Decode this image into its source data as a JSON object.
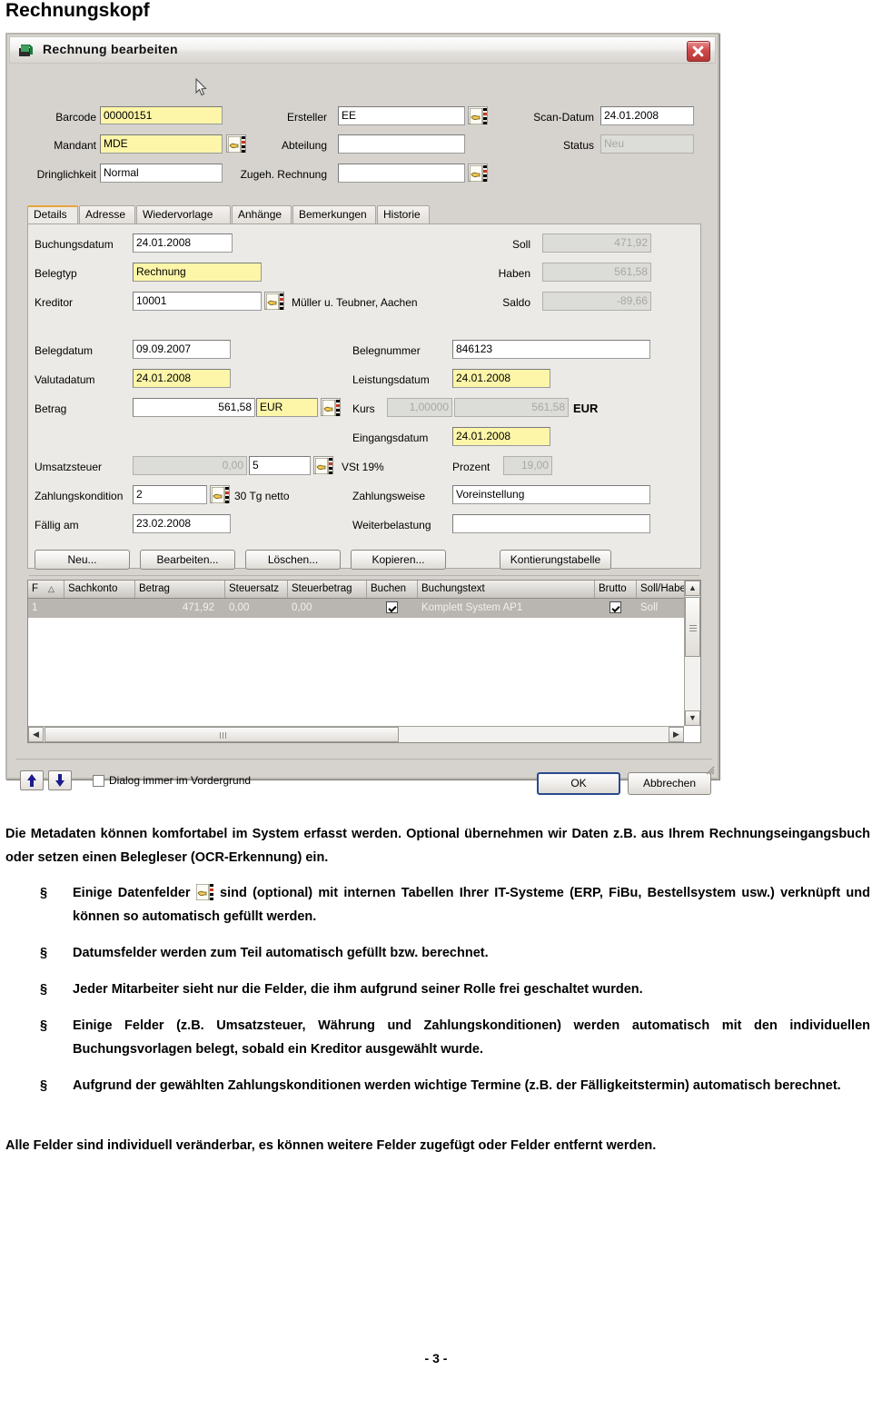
{
  "document": {
    "title": "Rechnungskopf",
    "page_number": "- 3 -",
    "intro": "Die Metadaten können komfortabel im System erfasst werden. Optional übernehmen wir Daten z.B. aus Ihrem Rechnungseingangsbuch oder setzen einen Belegleser (OCR-Erkennung) ein.",
    "bullet_marker": "§",
    "bullets": [
      {
        "before": "Einige Datenfelder",
        "after": "sind (optional) mit internen Tabellen Ihrer IT-Systeme (ERP, FiBu, Bestellsystem usw.)  verknüpft und können so automatisch gefüllt werden.",
        "has_icon": true
      },
      {
        "before": "Datumsfelder werden zum Teil automatisch gefüllt bzw. berechnet.",
        "after": "",
        "has_icon": false
      },
      {
        "before": "Jeder Mitarbeiter sieht nur die Felder, die ihm aufgrund seiner Rolle frei geschaltet wurden.",
        "after": "",
        "has_icon": false
      },
      {
        "before": "Einige Felder (z.B. Umsatzsteuer, Währung und Zahlungskonditionen) werden automatisch mit den individuellen Buchungsvorlagen belegt, sobald ein Kreditor ausgewählt wurde.",
        "after": "",
        "has_icon": false
      },
      {
        "before": "Aufgrund der gewählten Zahlungskonditionen werden wichtige Termine (z.B. der Fälligkeitstermin) automatisch berechnet.",
        "after": "",
        "has_icon": false
      }
    ],
    "outro": "Alle Felder sind individuell veränderbar, es können weitere Felder zugefügt oder Felder entfernt werden."
  },
  "dialog": {
    "title": "Rechnung bearbeiten",
    "close_label": "×",
    "header_fields": {
      "barcode": {
        "label": "Barcode",
        "value": "00000151"
      },
      "mandant": {
        "label": "Mandant",
        "value": "MDE"
      },
      "dringlichkeit": {
        "label": "Dringlichkeit",
        "value": "Normal"
      },
      "ersteller": {
        "label": "Ersteller",
        "value": "EE"
      },
      "abteilung": {
        "label": "Abteilung",
        "value": ""
      },
      "zugeh_rechnung": {
        "label": "Zugeh. Rechnung",
        "value": ""
      },
      "scan_datum": {
        "label": "Scan-Datum",
        "value": "24.01.2008"
      },
      "status": {
        "label": "Status",
        "value": "Neu"
      }
    },
    "tabs": [
      {
        "label": "Details",
        "active": true
      },
      {
        "label": "Adresse",
        "active": false
      },
      {
        "label": "Wiedervorlage",
        "active": false
      },
      {
        "label": "Anhänge",
        "active": false
      },
      {
        "label": "Bemerkungen",
        "active": false
      },
      {
        "label": "Historie",
        "active": false
      }
    ],
    "details": {
      "buchungsdatum": {
        "label": "Buchungsdatum",
        "value": "24.01.2008"
      },
      "belegtyp": {
        "label": "Belegtyp",
        "value": "Rechnung"
      },
      "kreditor": {
        "label": "Kreditor",
        "value": "10001",
        "description": "Müller u. Teubner, Aachen"
      },
      "soll": {
        "label": "Soll",
        "value": "471,92"
      },
      "haben": {
        "label": "Haben",
        "value": "561,58"
      },
      "saldo": {
        "label": "Saldo",
        "value": "-89,66"
      },
      "belegdatum": {
        "label": "Belegdatum",
        "value": "09.09.2007"
      },
      "valutadatum": {
        "label": "Valutadatum",
        "value": "24.01.2008"
      },
      "betrag": {
        "label": "Betrag",
        "value": "561,58",
        "currency": "EUR"
      },
      "belegnummer": {
        "label": "Belegnummer",
        "value": "846123"
      },
      "leistungsdatum": {
        "label": "Leistungsdatum",
        "value": "24.01.2008"
      },
      "kurs": {
        "label": "Kurs",
        "value": "1,00000",
        "converted": "561,58",
        "currency": "EUR"
      },
      "eingangsdatum": {
        "label": "Eingangsdatum",
        "value": "24.01.2008"
      },
      "umsatzsteuer": {
        "label": "Umsatzsteuer",
        "value": "0,00",
        "code": "5",
        "description": "VSt 19%"
      },
      "prozent": {
        "label": "Prozent",
        "value": "19,00"
      },
      "zahlungskondition": {
        "label": "Zahlungskondition",
        "value": "2",
        "description": "30 Tg netto"
      },
      "zahlungsweise": {
        "label": "Zahlungsweise",
        "value": "Voreinstellung"
      },
      "faellig_am": {
        "label": "Fällig am",
        "value": "23.02.2008"
      },
      "weiterbelastung": {
        "label": "Weiterbelastung",
        "value": ""
      }
    },
    "action_buttons": [
      {
        "label": "Neu..."
      },
      {
        "label": "Bearbeiten..."
      },
      {
        "label": "Löschen..."
      },
      {
        "label": "Kopieren..."
      },
      {
        "label": "Kontierungstabelle"
      }
    ],
    "grid": {
      "columns": [
        "F",
        "Sachkonto",
        "Betrag",
        "Steuersatz",
        "Steuerbetrag",
        "Buchen",
        "Buchungstext",
        "Brutto",
        "Soll/Haber"
      ],
      "rows": [
        {
          "f": "1",
          "sachkonto": "",
          "betrag": "471,92",
          "steuersatz": "0,00",
          "steuerbetrag": "0,00",
          "buchen": true,
          "buchungstext": "Komplett System AP1",
          "brutto": true,
          "soll_haben": "Soll"
        }
      ]
    },
    "footer": {
      "always_on_top_label": "Dialog immer im Vordergrund",
      "always_on_top_checked": false,
      "ok_label": "OK",
      "cancel_label": "Abbrechen"
    }
  },
  "colors": {
    "dialog_face": "#d6d3ce",
    "panel_face": "#eceae6",
    "highlight_yellow": "#fdf6a8",
    "disabled_gray": "#dcdcd8",
    "tab_accent": "#e8a33d",
    "close_red": "#cf4a4a"
  }
}
